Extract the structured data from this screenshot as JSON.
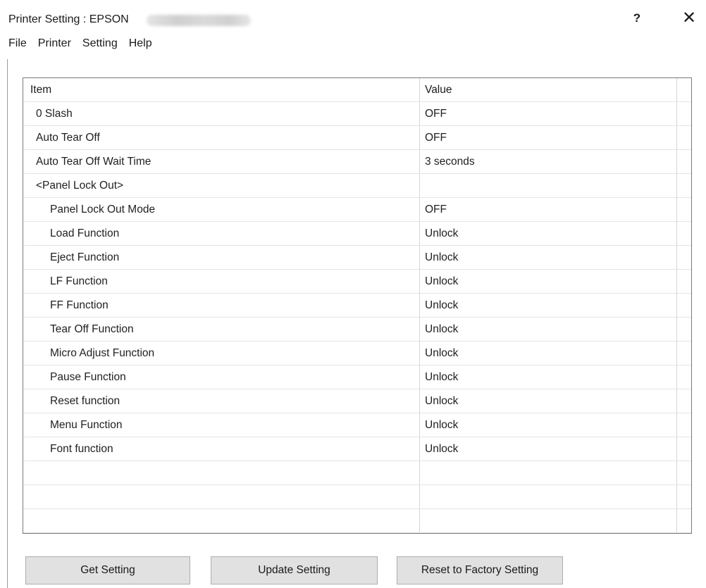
{
  "window": {
    "title": "Printer Setting : EPSON",
    "help_label": "?",
    "close_label": "✕"
  },
  "menu": [
    "File",
    "Printer",
    "Setting",
    "Help"
  ],
  "table": {
    "columns": [
      "Item",
      "Value"
    ],
    "rows": [
      {
        "item": "0 Slash",
        "value": "OFF",
        "indent": 1
      },
      {
        "item": "Auto Tear Off",
        "value": "OFF",
        "indent": 1
      },
      {
        "item": "Auto Tear Off Wait Time",
        "value": "3 seconds",
        "indent": 1
      },
      {
        "item": "<Panel Lock Out>",
        "value": "",
        "indent": 1
      },
      {
        "item": "Panel Lock Out Mode",
        "value": "OFF",
        "indent": 2
      },
      {
        "item": "Load Function",
        "value": "Unlock",
        "indent": 2
      },
      {
        "item": "Eject Function",
        "value": "Unlock",
        "indent": 2
      },
      {
        "item": "LF Function",
        "value": "Unlock",
        "indent": 2
      },
      {
        "item": "FF Function",
        "value": "Unlock",
        "indent": 2
      },
      {
        "item": "Tear Off Function",
        "value": "Unlock",
        "indent": 2
      },
      {
        "item": "Micro Adjust Function",
        "value": "Unlock",
        "indent": 2
      },
      {
        "item": "Pause Function",
        "value": "Unlock",
        "indent": 2
      },
      {
        "item": "Reset function",
        "value": "Unlock",
        "indent": 2
      },
      {
        "item": "Menu Function",
        "value": "Unlock",
        "indent": 2
      },
      {
        "item": "Font function",
        "value": "Unlock",
        "indent": 2
      }
    ]
  },
  "buttons": {
    "get_setting": "Get Setting",
    "update_setting": "Update Setting",
    "reset_factory": "Reset to Factory Setting"
  }
}
